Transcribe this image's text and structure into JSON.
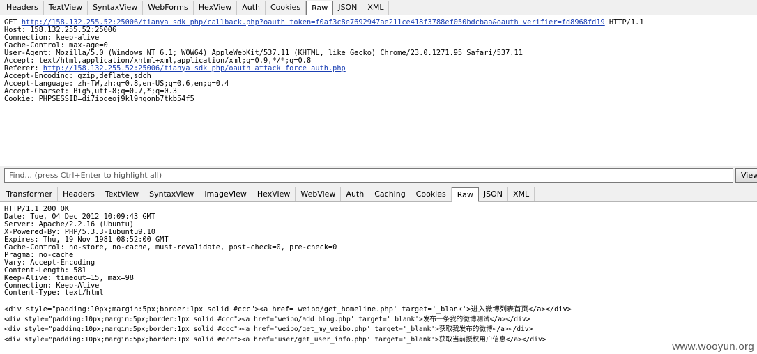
{
  "request_tabs": [
    "Headers",
    "TextView",
    "SyntaxView",
    "WebForms",
    "HexView",
    "Auth",
    "Cookies",
    "Raw",
    "JSON",
    "XML"
  ],
  "request_active": "Raw",
  "request": {
    "line_get_method": "GET ",
    "line_get_url": "http://158.132.255.52:25006/tianya_sdk_php/callback.php?oauth_token=f0af3c8e7692947ae211ce418f3788ef050bdcbaa&oauth_verifier=fd8968fd19",
    "line_get_proto": " HTTP/1.1",
    "host": "Host: 158.132.255.52:25006",
    "connection": "Connection: keep-alive",
    "cache_control": "Cache-Control: max-age=0",
    "user_agent": "User-Agent: Mozilla/5.0 (Windows NT 6.1; WOW64) AppleWebKit/537.11 (KHTML, like Gecko) Chrome/23.0.1271.95 Safari/537.11",
    "accept": "Accept: text/html,application/xhtml+xml,application/xml;q=0.9,*/*;q=0.8",
    "referer_label": "Referer: ",
    "referer_url": "http://158.132.255.52:25006/tianya_sdk_php/oauth_attack_force_auth.php",
    "accept_encoding": "Accept-Encoding: gzip,deflate,sdch",
    "accept_language": "Accept-Language: zh-TW,zh;q=0.8,en-US;q=0.6,en;q=0.4",
    "accept_charset": "Accept-Charset: Big5,utf-8;q=0.7,*;q=0.3",
    "cookie": "Cookie: PHPSESSID=di7ioqeoj9kl9nqonb7tkb54f5"
  },
  "find": {
    "placeholder": "Find... (press Ctrl+Enter to highlight all)",
    "view_button": "View"
  },
  "response_tabs": [
    "Transformer",
    "Headers",
    "TextView",
    "SyntaxView",
    "ImageView",
    "HexView",
    "WebView",
    "Auth",
    "Caching",
    "Cookies",
    "Raw",
    "JSON",
    "XML"
  ],
  "response_active": "Raw",
  "response": {
    "status": "HTTP/1.1 200 OK",
    "date": "Date: Tue, 04 Dec 2012 10:09:43 GMT",
    "server": "Server: Apache/2.2.16 (Ubuntu)",
    "powered_by": "X-Powered-By: PHP/5.3.3-1ubuntu9.10",
    "expires": "Expires: Thu, 19 Nov 1981 08:52:00 GMT",
    "cache_control": "Cache-Control: no-store, no-cache, must-revalidate, post-check=0, pre-check=0",
    "pragma": "Pragma: no-cache",
    "vary": "Vary: Accept-Encoding",
    "content_length": "Content-Length: 581",
    "keep_alive": "Keep-Alive: timeout=15, max=98",
    "connection": "Connection: Keep-Alive",
    "content_type": "Content-Type: text/html",
    "body": [
      {
        "code_pre": "<div style=\"padding:10px;margin:5px;border:1px solid #ccc\"><a href='weibo/get_homeline.php' target='_blank'>",
        "text": "进入微博列表首页",
        "code_post": "</a></div>"
      },
      {
        "code_pre": "<div style=\"padding:10px;margin:5px;border:1px solid #ccc\"><a href='weibo/add_blog.php' target='_blank'>",
        "text": "发布一条我的微博测试",
        "code_post": "</a></div>"
      },
      {
        "code_pre": "<div style=\"padding:10px;margin:5px;border:1px solid #ccc\"><a href='weibo/get_my_weibo.php' target='_blank'>",
        "text": "获取我发布的微博",
        "code_post": "</a></div>"
      },
      {
        "code_pre": "<div style=\"padding:10px;margin:5px;border:1px solid #ccc\"><a href='user/get_user_info.php' target='_blank'>",
        "text": "获取当前授权用户信息",
        "code_post": "</a></div>"
      }
    ]
  },
  "watermark": "www.wooyun.org"
}
